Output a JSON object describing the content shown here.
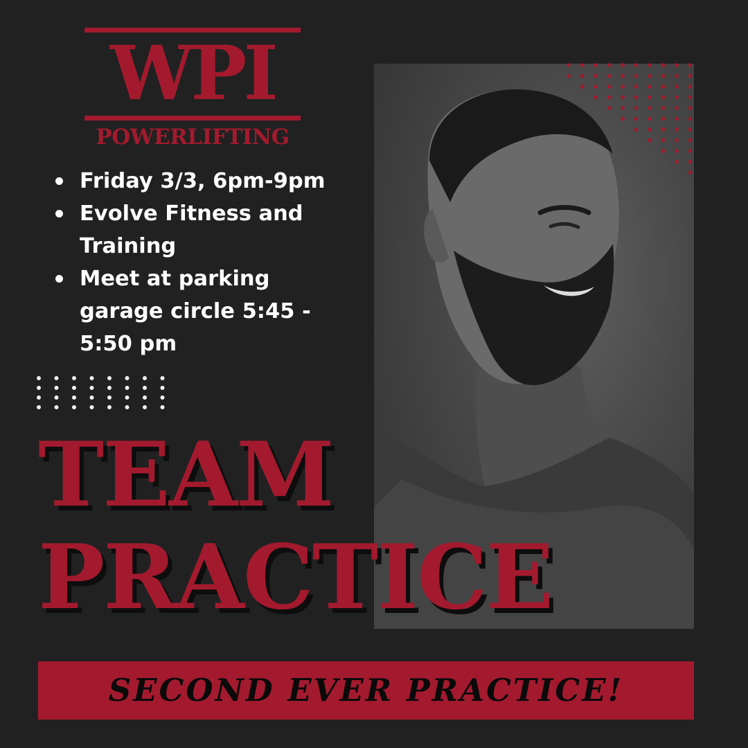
{
  "logo": {
    "title": "WPI",
    "subtitle": "POWERLIFTING"
  },
  "details": [
    "Friday 3/3, 6pm-9pm",
    "Evolve Fitness and Training",
    "Meet at parking garage circle 5:45 - 5:50 pm"
  ],
  "headline": {
    "line1": "TEAM",
    "line2": "PRACTICE"
  },
  "banner": {
    "text": "SECOND EVER PRACTICE!"
  },
  "colors": {
    "background": "#212121",
    "accent": "#a31a2e",
    "text": "#ffffff"
  },
  "photo": {
    "icon": "bearded-man-portrait"
  }
}
